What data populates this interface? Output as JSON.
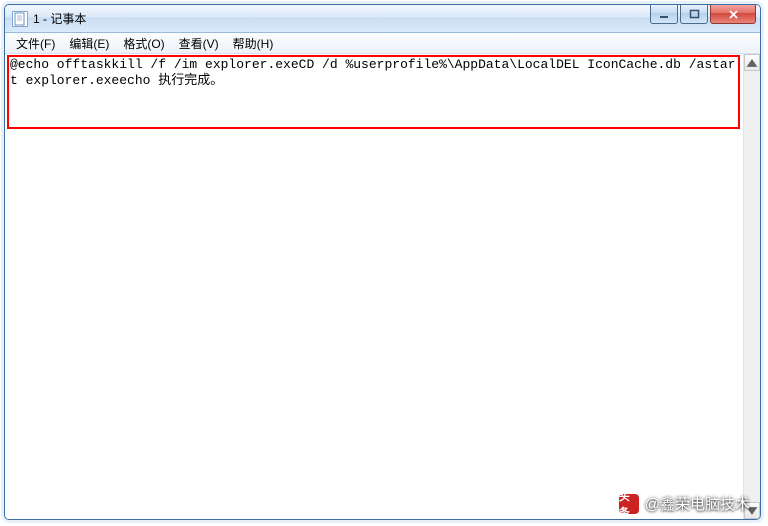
{
  "window": {
    "title": "1 - 记事本"
  },
  "menu": {
    "file": "文件(F)",
    "edit": "编辑(E)",
    "format": "格式(O)",
    "view": "查看(V)",
    "help": "帮助(H)"
  },
  "editor": {
    "content": "@echo offtaskkill /f /im explorer.exeCD /d %userprofile%\\AppData\\LocalDEL IconCache.db /astart explorer.exeecho 执行完成。"
  },
  "watermark": {
    "logo_text": "头条",
    "text": "@鑫荣电脑技术"
  }
}
